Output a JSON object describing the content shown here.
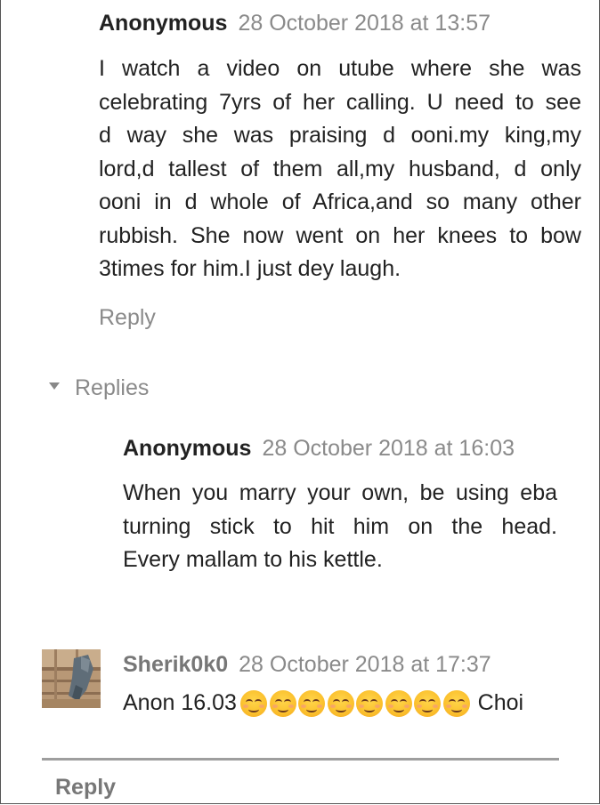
{
  "comments": [
    {
      "author": "Anonymous",
      "timestamp": "28 October 2018 at 13:57",
      "lines": [
        "I watch a video on utube where she was",
        "celebrating 7yrs of her calling. U need to see",
        "d way she was praising d ooni.my king,my",
        "lord,d tallest of them all,my husband, d only",
        "ooni in d whole of Africa,and so many other",
        "rubbish. She now went on her knees to bow",
        "3times for him.I just dey laugh."
      ],
      "reply_label": "Reply"
    }
  ],
  "replies_toggle": {
    "label": "Replies",
    "icon": "caret-down-icon"
  },
  "replies": [
    {
      "author": "Anonymous",
      "timestamp": "28 October 2018 at 16:03",
      "lines": [
        "When you marry your own, be using eba",
        "turning stick to hit him on the head.",
        "Every mallam to his kettle."
      ]
    },
    {
      "author": "Sherik0k0",
      "timestamp": "28 October 2018 at 17:37",
      "text_before": "Anon 16.03",
      "emoji": "smiling-face-with-smiling-eyes",
      "emoji_count": 8,
      "text_after": "Choi",
      "avatar": "avatar-photo"
    }
  ],
  "bottom_reply_label": "Reply",
  "colors": {
    "text": "#222222",
    "muted": "#8a8a8a",
    "divider": "#9e9e9e",
    "emoji": "#fbc02d"
  }
}
